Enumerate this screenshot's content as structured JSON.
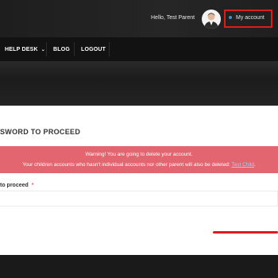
{
  "header": {
    "greeting": "Hello, Test Parent",
    "my_account": "My account"
  },
  "nav": {
    "items": [
      {
        "label": "HELP DESK",
        "has_dropdown": true
      },
      {
        "label": "BLOG"
      },
      {
        "label": "LOGOUT"
      }
    ]
  },
  "main": {
    "heading": "SWORD TO PROCEED",
    "alert": {
      "line1": "Warning! You are going to delete your account.",
      "line2_text": "Your children accounts who hasn't individual accounts nor other parent will also be deleted:",
      "child_link": "Test Child",
      "line2_end": "."
    },
    "field_label": "to proceed",
    "required_mark": "*",
    "password_value": ""
  },
  "colors": {
    "accent_red": "#e01b1b",
    "alert_bg": "#e36570",
    "link_blue": "#9fd3ff"
  }
}
